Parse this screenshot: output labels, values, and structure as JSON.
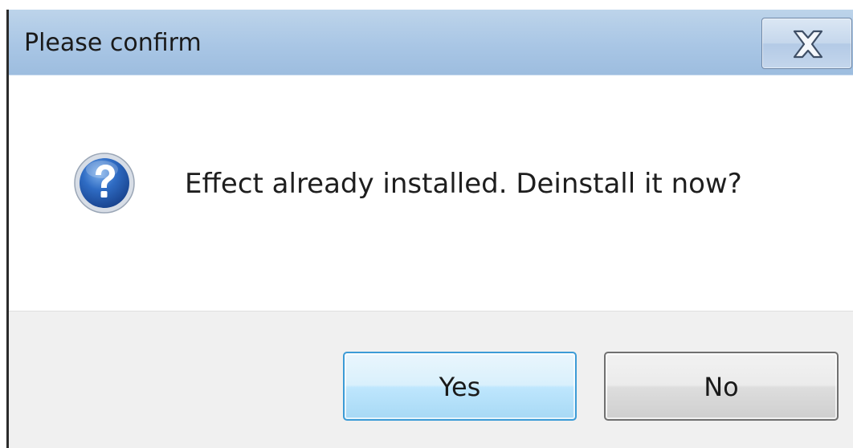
{
  "window": {
    "title": "Please confirm",
    "close_icon": "close-icon"
  },
  "message": {
    "icon": "question-icon",
    "text": "Effect already installed. Deinstall it now?"
  },
  "buttons": {
    "yes_label": "Yes",
    "no_label": "No"
  },
  "colors": {
    "titlebar": "#a9c6e5",
    "footer": "#f0f0f0",
    "default_button_border": "#3c9bd6",
    "question_icon_blue": "#2a63b4"
  }
}
